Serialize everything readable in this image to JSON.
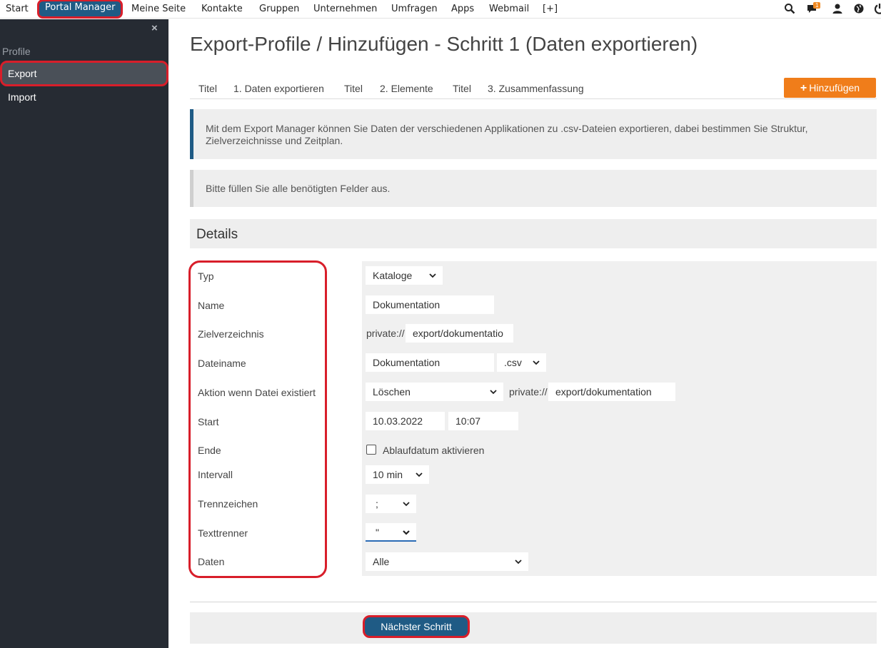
{
  "topnav": {
    "items": [
      "Start",
      "Portal Manager",
      "Meine Seite",
      "Kontakte",
      "Gruppen",
      "Unternehmen",
      "Umfragen",
      "Apps",
      "Webmail",
      "[+]"
    ],
    "badge_count": "1",
    "icons": [
      "search-icon",
      "chat-icon",
      "user-icon",
      "globe-icon",
      "power-icon"
    ]
  },
  "sidebar": {
    "close": "×",
    "section": "Profile",
    "items": [
      "Export",
      "Import"
    ]
  },
  "main": {
    "title": "Export-Profile / Hinzufügen - Schritt 1 (Daten exportieren)",
    "steps": [
      "Titel",
      "1. Daten exportieren",
      "Titel",
      "2. Elemente",
      "Titel",
      "3. Zusammenfassung"
    ],
    "add_button": "Hinzufügen",
    "info1": "Mit dem Export Manager können Sie Daten der verschiedenen Applikationen zu .csv-Dateien exportieren, dabei bestimmen Sie Struktur, Zielverzeichnisse und Zeitplan.",
    "info2": "Bitte füllen Sie alle benötigten Felder aus.",
    "details": "Details",
    "next_button": "Nächster Schritt"
  },
  "form": {
    "labels": [
      "Typ",
      "Name",
      "Zielverzeichnis",
      "Dateiname",
      "Aktion wenn Datei existiert",
      "Start",
      "Ende",
      "Intervall",
      "Trennzeichen",
      "Texttrenner",
      "Daten"
    ],
    "typ": "Kataloge",
    "name": "Dokumentation",
    "ziel_prefix": "private://",
    "ziel_value": "export/dokumentatio",
    "dateiname": "Dokumentation",
    "extension": ".csv",
    "aktion": "Löschen",
    "aktion_prefix": "private://",
    "aktion_value": "export/dokumentation",
    "start_date": "10.03.2022",
    "start_time": "10:07",
    "ende_checkbox": "Ablaufdatum aktivieren",
    "intervall": "10 min",
    "trennzeichen": ";",
    "texttrenner": "\"",
    "daten": "Alle"
  }
}
